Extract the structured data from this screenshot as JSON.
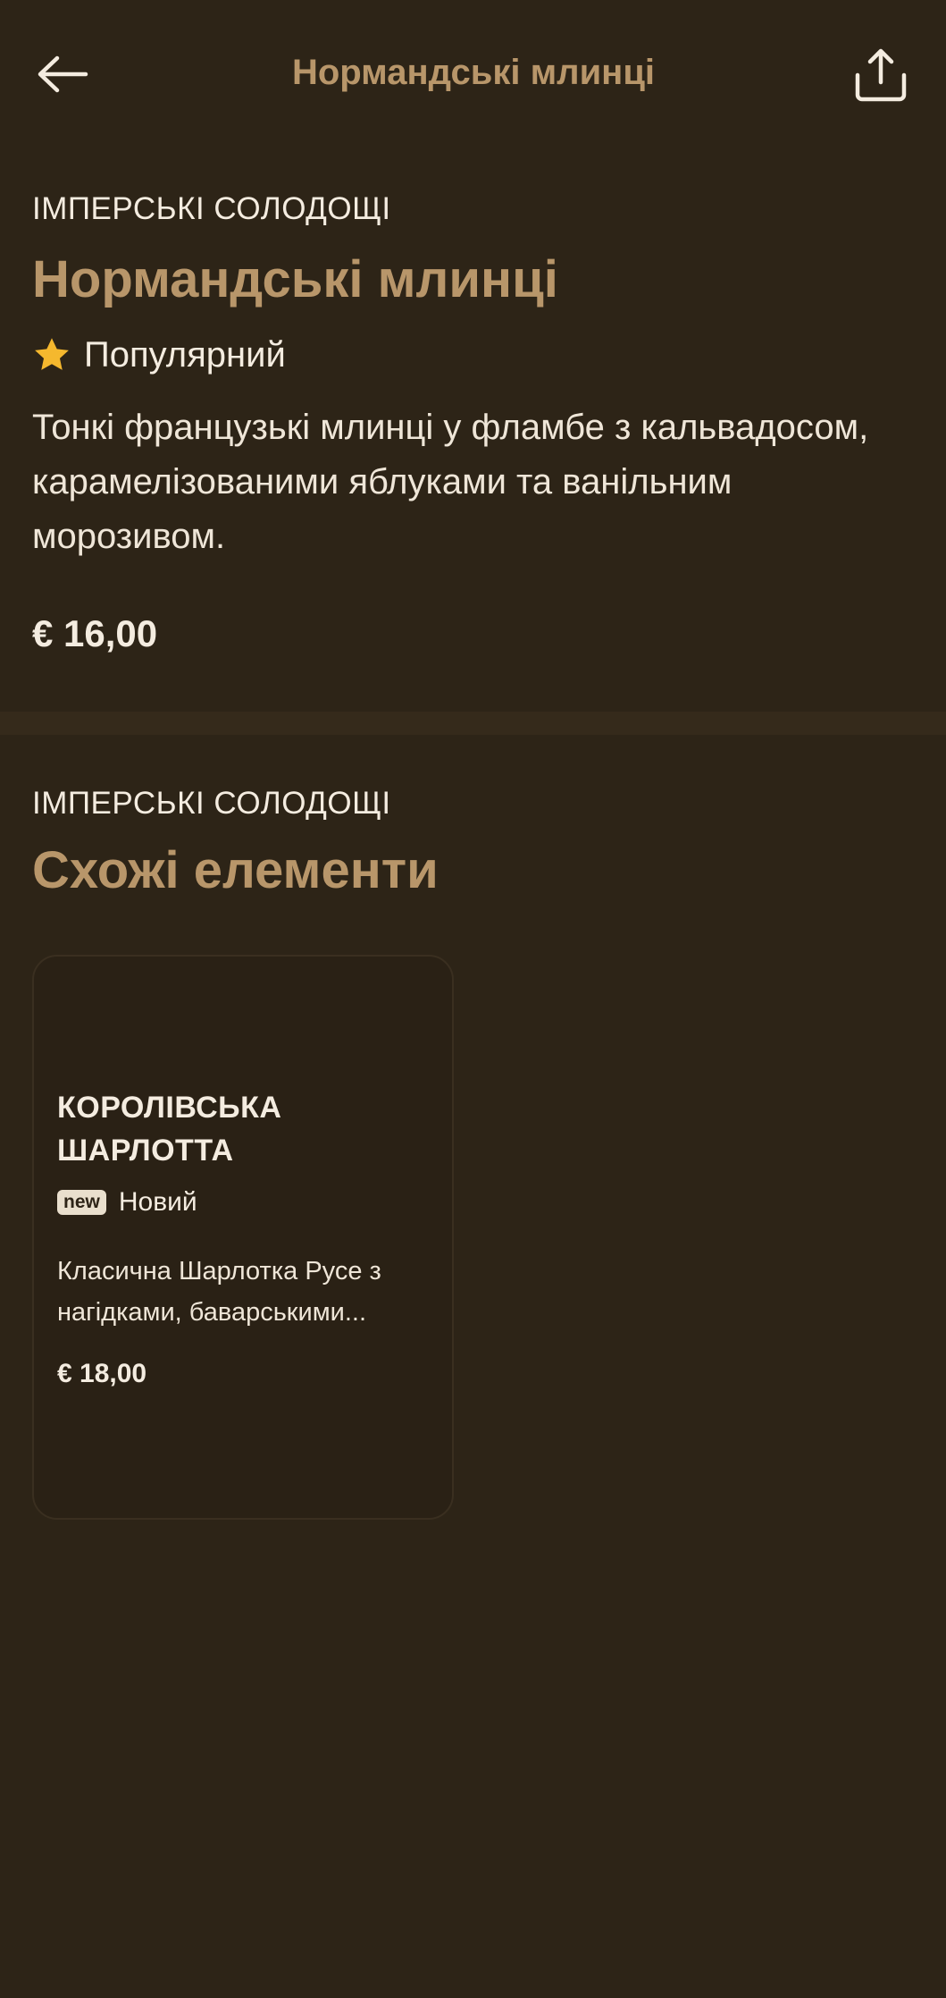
{
  "header": {
    "title": "Нормандські млинці"
  },
  "product": {
    "category": "ІМПЕРСЬКІ СОЛОДОЩІ",
    "name": "Нормандські млинці",
    "badge_label": "Популярний",
    "description": "Тонкі французькі млинці у фламбе з кальвадосом, карамелізованими яблуками та ванільним морозивом.",
    "price": "€ 16,00"
  },
  "similar": {
    "category": "ІМПЕРСЬКІ СОЛОДОЩІ",
    "title": "Схожі елементи",
    "items": [
      {
        "name": "КОРОЛІВСЬКА ШАРЛОТТА",
        "badge_tag": "new",
        "badge_label": "Новий",
        "description": "Класична Шарлотка Русе з нагідками, баварськими...",
        "price": "€ 18,00"
      }
    ]
  },
  "icons": {
    "back": "arrow-left-icon",
    "share": "share-icon",
    "popular": "star-icon"
  },
  "colors": {
    "background": "#2d2417",
    "accent": "#b8966a",
    "text": "#f4ece0",
    "star": "#f5b82e"
  }
}
